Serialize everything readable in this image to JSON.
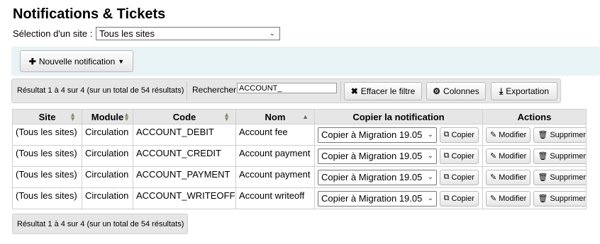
{
  "page": {
    "title": "Notifications & Tickets"
  },
  "site_filter": {
    "label": "Sélection d'un site :",
    "value": "Tous les sites"
  },
  "toolbar": {
    "new_notification": "Nouvelle notification"
  },
  "info": {
    "results_text": "Résultat 1 à 4 sur 4 (sur un total de 54 résultats)"
  },
  "search": {
    "label": "Rechercher :",
    "value": "ACCOUNT_"
  },
  "buttons": {
    "clear_filter": "Effacer le filtre",
    "columns": "Colonnes",
    "export": "Exportation"
  },
  "table": {
    "headers": {
      "site": "Site",
      "module": "Module",
      "code": "Code",
      "name": "Nom",
      "copy": "Copier la notification",
      "actions": "Actions"
    },
    "copy_button": "Copier",
    "modify_button": "Modifier",
    "delete_button": "Supprimer",
    "rows": [
      {
        "site": "(Tous les sites)",
        "module": "Circulation",
        "code": "ACCOUNT_DEBIT",
        "name": "Account fee",
        "copy_target": "Copier à Migration 19.05"
      },
      {
        "site": "(Tous les sites)",
        "module": "Circulation",
        "code": "ACCOUNT_CREDIT",
        "name": "Account payment",
        "copy_target": "Copier à Migration 19.05"
      },
      {
        "site": "(Tous les sites)",
        "module": "Circulation",
        "code": "ACCOUNT_PAYMENT",
        "name": "Account payment",
        "copy_target": "Copier à Migration 19.05"
      },
      {
        "site": "(Tous les sites)",
        "module": "Circulation",
        "code": "ACCOUNT_WRITEOFF",
        "name": "Account writeoff",
        "copy_target": "Copier à Migration 19.05"
      }
    ]
  },
  "footer": {
    "results_text": "Résultat 1 à 4 sur 4 (sur un total de 54 résultats)"
  }
}
